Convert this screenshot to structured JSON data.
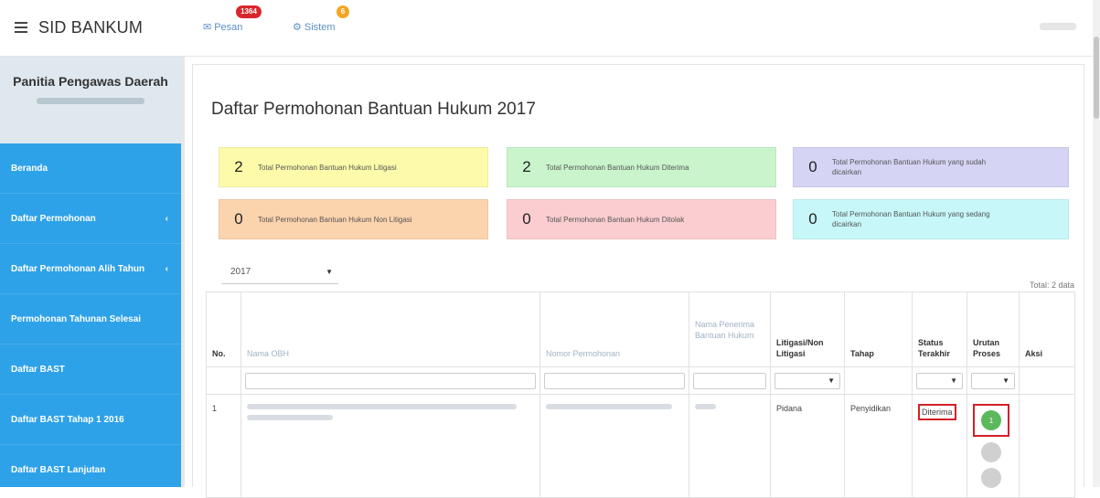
{
  "topbar": {
    "brand": "SID BANKUM",
    "pesan_label": "Pesan",
    "pesan_badge": "1364",
    "sistem_label": "Sistem",
    "sistem_badge": "6"
  },
  "sidebar": {
    "role": "Panitia Pengawas Daerah",
    "items": [
      {
        "label": "Beranda",
        "has_chevron": false
      },
      {
        "label": "Daftar Permohonan",
        "has_chevron": true
      },
      {
        "label": "Daftar Permohonan Alih Tahun",
        "has_chevron": true
      },
      {
        "label": "Permohonan Tahunan Selesai",
        "has_chevron": false
      },
      {
        "label": "Daftar BAST",
        "has_chevron": false
      },
      {
        "label": "Daftar BAST Tahap 1 2016",
        "has_chevron": false
      },
      {
        "label": "Daftar BAST Lanjutan",
        "has_chevron": false
      }
    ]
  },
  "main": {
    "title": "Daftar Permohonan Bantuan Hukum 2017",
    "stats": [
      {
        "value": "2",
        "label": "Total Permohonan Bantuan Hukum Litigasi",
        "color": "#fdfbaa"
      },
      {
        "value": "2",
        "label": "Total Permohonan Bantuan Hukum Diterima",
        "color": "#c9f4cc"
      },
      {
        "value": "0",
        "label": "Total Permohonan Bantuan Hukum yang sudah dicairkan",
        "color": "#d5d4f5"
      },
      {
        "value": "0",
        "label": "Total Permohonan Bantuan Hukum Non Litigasi",
        "color": "#fbd3ad"
      },
      {
        "value": "0",
        "label": "Total Permohonan Bantuan Hukum Ditolak",
        "color": "#fbcdd0"
      },
      {
        "value": "0",
        "label": "Total Permohonan Bantuan Hukum yang sedang dicairkan",
        "color": "#c7f7f8"
      }
    ],
    "year": "2017",
    "total_text": "Total: 2 data"
  },
  "table": {
    "headers": [
      "No.",
      "Nama OBH",
      "Nomor Permohonan",
      "Nama Penerima Bantuan Hukum",
      "Litigasi/Non Litigasi",
      "Tahap",
      "Status Terakhir",
      "Urutan Proses",
      "Aksi"
    ],
    "rows": [
      {
        "no": "1",
        "jenis": "Pidana",
        "tahap": "Penyidikan",
        "status": "Diterima",
        "proses_step": "1"
      }
    ]
  },
  "icons": {
    "menu": "hamburger-icon",
    "pesan": "envelope-icon",
    "sistem": "cogs-icon"
  }
}
